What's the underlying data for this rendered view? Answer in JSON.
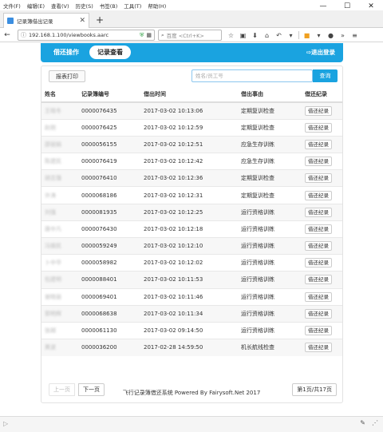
{
  "menubar": {
    "items": [
      "文件(F)",
      "编辑(E)",
      "查看(V)",
      "历史(S)",
      "书签(B)",
      "工具(T)",
      "帮助(H)"
    ],
    "window_controls": [
      "—",
      "☐",
      "✕"
    ]
  },
  "tab": {
    "title": "记录簿借出记录",
    "close": "✕",
    "new_tab": "+"
  },
  "navbar": {
    "back": "←",
    "url": "192.168.1.100/viewbooks.aarc",
    "search_placeholder": "百度 <Ctrl+K>"
  },
  "header": {
    "nav_return": "借还操作",
    "nav_view": "记录查看",
    "logout": "退出登录"
  },
  "toolbar": {
    "print_label": "报表打印",
    "search_placeholder": "姓名/员工号",
    "search_button": "查询"
  },
  "table": {
    "headers": [
      "姓名",
      "记录簿编号",
      "借出时间",
      "借出事由",
      "借还纪录"
    ],
    "record_button": "借还纪录",
    "rows": [
      {
        "name": "王晓冬",
        "id": "0000076435",
        "time": "2017-03-02 10:13:06",
        "reason": "定期复训检查"
      },
      {
        "name": "赵刚",
        "id": "0000076425",
        "time": "2017-03-02 10:12:59",
        "reason": "定期复训检查"
      },
      {
        "name": "邵丽娟",
        "id": "0000056155",
        "time": "2017-03-02 10:12:51",
        "reason": "应急生存训练"
      },
      {
        "name": "陈建民",
        "id": "0000076419",
        "time": "2017-03-02 10:12:42",
        "reason": "应急生存训练"
      },
      {
        "name": "胡志强",
        "id": "0000076410",
        "time": "2017-03-02 10:12:36",
        "reason": "定期复训检查"
      },
      {
        "name": "许涛",
        "id": "0000068186",
        "time": "2017-03-02 10:12:31",
        "reason": "定期复训检查"
      },
      {
        "name": "刘强",
        "id": "0000081935",
        "time": "2017-03-02 10:12:25",
        "reason": "运行资格训练"
      },
      {
        "name": "唐中凡",
        "id": "0000076430",
        "time": "2017-03-02 10:12:18",
        "reason": "运行资格训练"
      },
      {
        "name": "冯振民",
        "id": "0000059249",
        "time": "2017-03-02 10:12:10",
        "reason": "运行资格训练"
      },
      {
        "name": "卜中华",
        "id": "0000058982",
        "time": "2017-03-02 10:12:02",
        "reason": "运行资格训练"
      },
      {
        "name": "包建明",
        "id": "0000088401",
        "time": "2017-03-02 10:11:53",
        "reason": "运行资格训练"
      },
      {
        "name": "谢晓丽",
        "id": "0000069401",
        "time": "2017-03-02 10:11:46",
        "reason": "运行资格训练"
      },
      {
        "name": "郭明辉",
        "id": "0000068638",
        "time": "2017-03-02 10:11:34",
        "reason": "运行资格训练"
      },
      {
        "name": "张越",
        "id": "0000061130",
        "time": "2017-03-02 09:14:50",
        "reason": "运行资格训练"
      },
      {
        "name": "黄波",
        "id": "0000036200",
        "time": "2017-02-28 14:59:50",
        "reason": "机长航线检查"
      }
    ]
  },
  "pager": {
    "prev": "上一页",
    "next": "下一页",
    "page_info": "第1页/共17页"
  },
  "footer": "飞行记录簿借还系统 Powered By Fairysoft.Net 2017"
}
